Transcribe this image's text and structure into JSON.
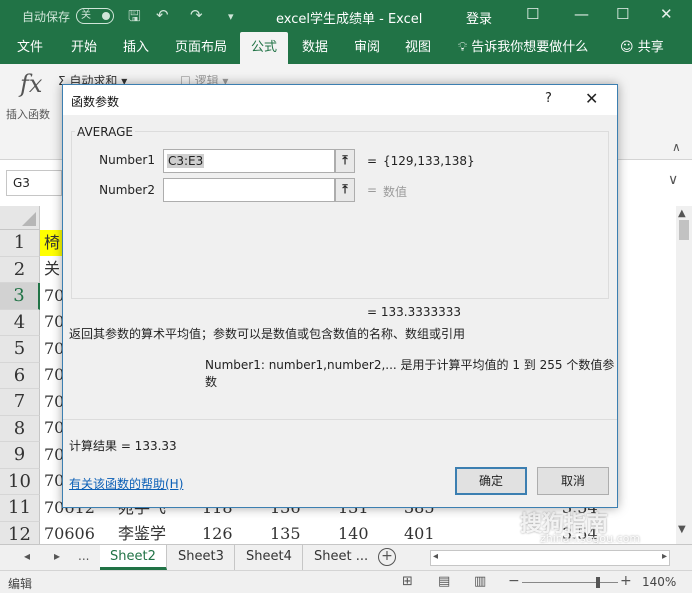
{
  "titlebar": {
    "autosave_label": "自动保存",
    "autosave_state": "关",
    "doc_title": "excel学生成绩单 - Excel",
    "login": "登录"
  },
  "tabs": [
    "文件",
    "开始",
    "插入",
    "页面布局",
    "公式",
    "数据",
    "审阅",
    "视图"
  ],
  "active_tab": "公式",
  "tell_me": "告诉我你想要做什么",
  "share": "共享",
  "ribbon": {
    "insert_function_label": "插入函数",
    "fx_glyph": "fx",
    "autosum_label": "自动求和",
    "logic_label": "逻辑"
  },
  "namebox": "G3",
  "grid": {
    "rows": [
      "1",
      "2",
      "3",
      "4",
      "5",
      "6",
      "7",
      "8",
      "9",
      "10",
      "11",
      "12"
    ],
    "selected_row": "3",
    "row1_partial": "椅",
    "row2_partial": "关",
    "partial_ids": [
      "70",
      "70",
      "70",
      "70",
      "70",
      "70",
      "70",
      "70"
    ],
    "row11": [
      "70612",
      "宛手飞",
      "118",
      "136",
      "131",
      "385",
      "3.54"
    ],
    "row12": [
      "70606",
      "李鉴学",
      "126",
      "135",
      "140",
      "401",
      "3.54"
    ]
  },
  "sheets": [
    "Sheet2",
    "Sheet3",
    "Sheet4",
    "Sheet ..."
  ],
  "active_sheet": "Sheet2",
  "sheet_nav": {
    "ellipsis": "..."
  },
  "status": {
    "mode": "编辑",
    "zoom": "140%"
  },
  "watermark": {
    "text": "搜狗指南",
    "sub": "zhinan.sogou.com"
  },
  "dialog": {
    "title": "函数参数",
    "help_glyph": "?",
    "close_glyph": "✕",
    "function_name": "AVERAGE",
    "args": [
      {
        "label": "Number1",
        "value": "C3:E3",
        "result": "{129,133,138}"
      },
      {
        "label": "Number2",
        "value": "",
        "result": "数值"
      }
    ],
    "eq": "=",
    "overall_result": "=  133.3333333",
    "description": "返回其参数的算术平均值；参数可以是数值或包含数值的名称、数组或引用",
    "arg_description": "Number1:  number1,number2,... 是用于计算平均值的 1 到 255 个数值参数",
    "calc_result": "计算结果 =   133.33",
    "help_link": "有关该函数的帮助(H)",
    "ok": "确定",
    "cancel": "取消"
  }
}
